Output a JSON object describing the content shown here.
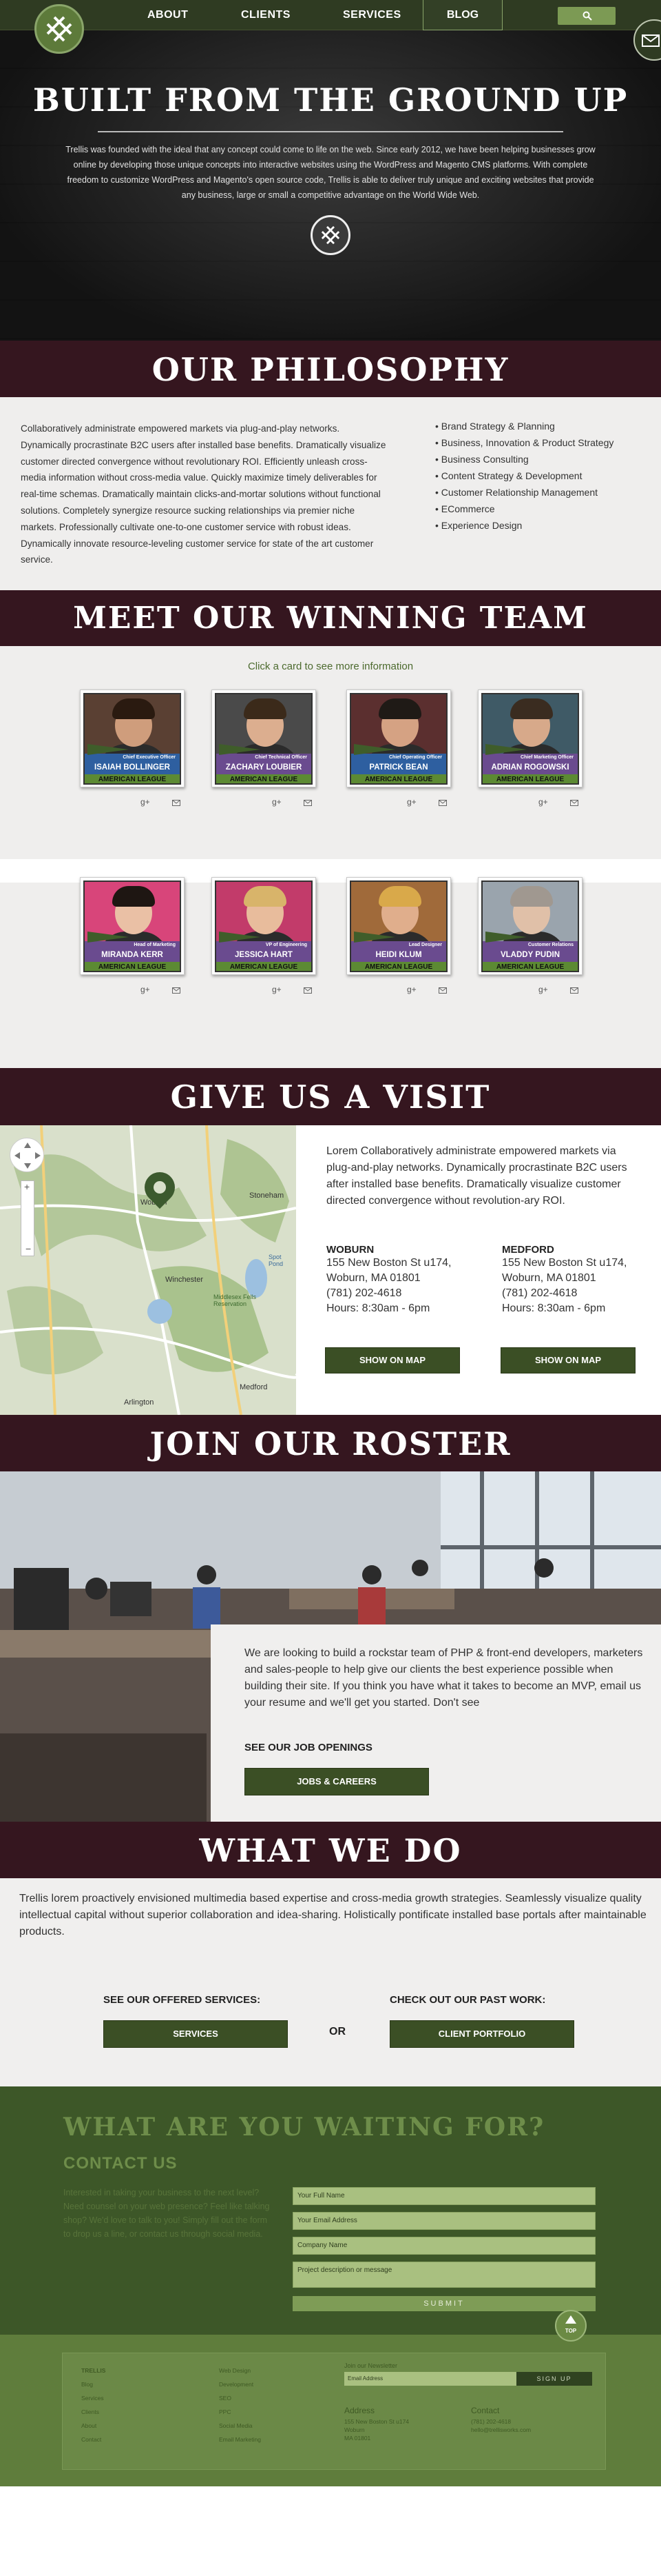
{
  "nav": {
    "links": [
      "ABOUT",
      "CLIENTS",
      "SERVICES"
    ],
    "blog": "BLOG"
  },
  "hero": {
    "title": "BUILT FROM THE GROUND UP",
    "text": "Trellis was founded with the ideal that any concept could come to life on the web. Since early 2012, we have been helping businesses grow online by developing those unique concepts into interactive websites using the WordPress and Magento CMS platforms. With complete freedom to customize WordPress and Magento's open source code, Trellis is able to deliver truly unique and exciting websites that provide any business, large or small a competitive advantage on the World Wide Web."
  },
  "philosophy": {
    "title": "OUR PHILOSOPHY",
    "text": "Collaboratively administrate empowered markets via plug-and-play networks. Dynamically procrastinate B2C users after installed base benefits. Dramatically visualize customer directed convergence without revolutionary ROI. Efficiently unleash cross-media information without cross-media value. Quickly maximize timely deliverables for real-time schemas. Dramatically maintain clicks-and-mortar solutions without functional solutions. Completely synergize resource sucking relationships via premier niche markets. Professionally cultivate one-to-one customer service with robust ideas. Dynamically innovate resource-leveling customer service for state of the art customer service.",
    "services": [
      "Brand Strategy & Planning",
      "Business, Innovation & Product Strategy",
      "Business Consulting",
      "Content Strategy & Development",
      "Customer Relationship Management",
      "ECommerce",
      "Experience Design"
    ]
  },
  "team": {
    "title": "MEET OUR WINNING TEAM",
    "hint": "Click a card to see more information",
    "league": "AMERICAN LEAGUE",
    "members": [
      {
        "name": "ISAIAH BOLLINGER",
        "role": "Chief Executive Officer",
        "strip": "#2e5fa0",
        "hair": "#2a1a10",
        "skin": "#cf9d7c",
        "bg": "#5a4033"
      },
      {
        "name": "ZACHARY LOUBIER",
        "role": "Chief Technical Officer",
        "strip": "#6a4b8f",
        "hair": "#3b2a1a",
        "skin": "#dcae8f",
        "bg": "#4a4a4a"
      },
      {
        "name": "PATRICK BEAN",
        "role": "Chief Operating Officer",
        "strip": "#2e5fa0",
        "hair": "#1f1a16",
        "skin": "#d5a283",
        "bg": "#5b2f2f"
      },
      {
        "name": "ADRIAN ROGOWSKI",
        "role": "Chief Marketing Officer",
        "strip": "#6a4b8f",
        "hair": "#3a2c20",
        "skin": "#d7a98a",
        "bg": "#3f5a66"
      },
      {
        "name": "MIRANDA KERR",
        "role": "Head of Marketing",
        "strip": "#6a4b8f",
        "hair": "#1e1612",
        "skin": "#eac0a5",
        "bg": "#d8457a"
      },
      {
        "name": "JESSICA HART",
        "role": "VP of Engineering",
        "strip": "#6a4b8f",
        "hair": "#d8b46a",
        "skin": "#e8bc9c",
        "bg": "#c23b6a"
      },
      {
        "name": "HEIDI KLUM",
        "role": "Lead Designer",
        "strip": "#6a4b8f",
        "hair": "#d9a94a",
        "skin": "#e0ae8c",
        "bg": "#a06a3a"
      },
      {
        "name": "VLADDY PUDIN",
        "role": "Customer Relations",
        "strip": "#6a4b8f",
        "hair": "#a09890",
        "skin": "#e0c0a8",
        "bg": "#9aa4ad"
      }
    ]
  },
  "visit": {
    "title": "GIVE US A VISIT",
    "text": "Lorem Collaboratively administrate empowered markets via plug-and-play networks. Dynamically procrastinate B2C users after installed base benefits. Dramatically visualize customer directed convergence without revolution-ary ROI.",
    "locations": [
      {
        "name": "WOBURN",
        "street": "155 New Boston St u174,",
        "city": "Woburn, MA 01801",
        "phone": "(781) 202-4618",
        "hours": "Hours: 8:30am - 6pm",
        "button": "SHOW ON MAP"
      },
      {
        "name": "MEDFORD",
        "street": "155 New Boston St u174,",
        "city": "Woburn, MA 01801",
        "phone": "(781) 202-4618",
        "hours": "Hours: 8:30am - 6pm",
        "button": "SHOW ON MAP"
      }
    ],
    "map_labels": [
      "Woburn",
      "Stoneham",
      "Winchester",
      "Medford",
      "Arlington",
      "Middlesex Fells Reservation",
      "Spot Pond"
    ]
  },
  "roster": {
    "title": "JOIN OUR ROSTER",
    "text": "We are looking to build a rockstar team of PHP & front-end developers, marketers and sales-people to help give our clients the best experience possible when building their site. If you think you have what it takes to become an MVP, email us your resume and we'll get you started. Don't see",
    "openings_label": "SEE OUR JOB OPENINGS",
    "button": "JOBS & CAREERS"
  },
  "wwd": {
    "title": "WHAT WE DO",
    "text": "Trellis lorem proactively envisioned multimedia based expertise and cross-media growth strategies. Seamlessly visualize quality intellectual capital without superior collaboration and idea-sharing. Holistically pontificate installed base portals after maintainable products.",
    "services_label": "SEE OUR OFFERED SERVICES:",
    "services_button": "SERVICES",
    "or": "OR",
    "work_label": "CHECK OUT OUR PAST WORK:",
    "work_button": "CLIENT PORTFOLIO"
  },
  "cta": {
    "title": "WHAT ARE YOU WAITING FOR?",
    "subtitle": "CONTACT US",
    "text": "Interested in taking your business to the next level? Need counsel on your web presence? Feel like talking shop? We'd love to talk to you! Simply fill out the form to drop us a line, or contact us through social media.",
    "fields": [
      "Your Full Name",
      "Your Email Address",
      "Company Name",
      "Project description or message"
    ],
    "submit": "SUBMIT",
    "top": "TOP"
  },
  "footer": {
    "col1_title": "TRELLIS",
    "col1": [
      "Blog",
      "Services",
      "Clients",
      "About",
      "Contact"
    ],
    "col2": [
      "Web Design",
      "Development",
      "SEO",
      "PPC",
      "Social Media",
      "Email Marketing"
    ],
    "newsletter": "Join our Newsletter",
    "email_placeholder": "Email Address",
    "signup": "SIGN UP",
    "address_title": "Address",
    "address": [
      "155 New Boston St u174",
      "Woburn",
      "MA 01801"
    ],
    "contact_title": "Contact",
    "contact": [
      "(781) 202-4618",
      "hello@trellisworks.com"
    ]
  },
  "colors": {
    "dark_green": "#3b4f25",
    "maroon": "#35161f",
    "light_bg": "#efeeed"
  }
}
